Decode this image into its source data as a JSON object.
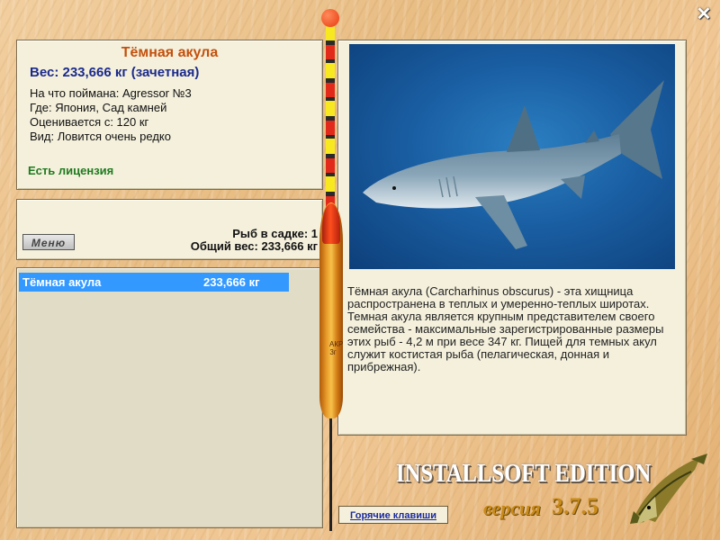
{
  "window": {
    "close_label": "✕"
  },
  "fish_info": {
    "name": "Тёмная акула",
    "weight_line": "Вес: 233,666 кг (зачетная)",
    "bait_line": "На что поймана: Agressor №3",
    "location_line": "Где: Япония, Сад камней",
    "value_line": "Оценивается с: 120 кг",
    "rarity_line": "Вид: Ловится очень редко",
    "license_text": "Есть лицензия"
  },
  "catch_summary": {
    "menu_label": "Меню",
    "fish_count_line": "Рыб в садке: 1",
    "total_weight_line": "Общий вес: 233,666 кг"
  },
  "fish_list": [
    {
      "name": "Тёмная акула",
      "weight": "233,666 кг",
      "selected": true
    }
  ],
  "description": {
    "text": "Тёмная акула (Carcharhinus obscurus) - эта хищница распространена в теплых и умеренно-теплых широтах. Темная акула является крупным представителем своего семейства - максимальные зарегистрированные размеры этих рыб - 4,2 м при весе 347 кг. Пищей для темных акул служит костистая рыба (пелагическая, донная и прибрежная)."
  },
  "float": {
    "marking": "АКР 3г"
  },
  "footer": {
    "hotkeys_label": "Горячие клавиши",
    "brand": "INSTALLSOFT EDITION",
    "version_label": "версия",
    "version_number": "3.7.5"
  },
  "colors": {
    "fish_name": "#c4500c",
    "weight": "#1a2a8c",
    "license": "#1f7a1f",
    "selection": "#3399ff",
    "panel_bg": "#f4f0dc"
  }
}
